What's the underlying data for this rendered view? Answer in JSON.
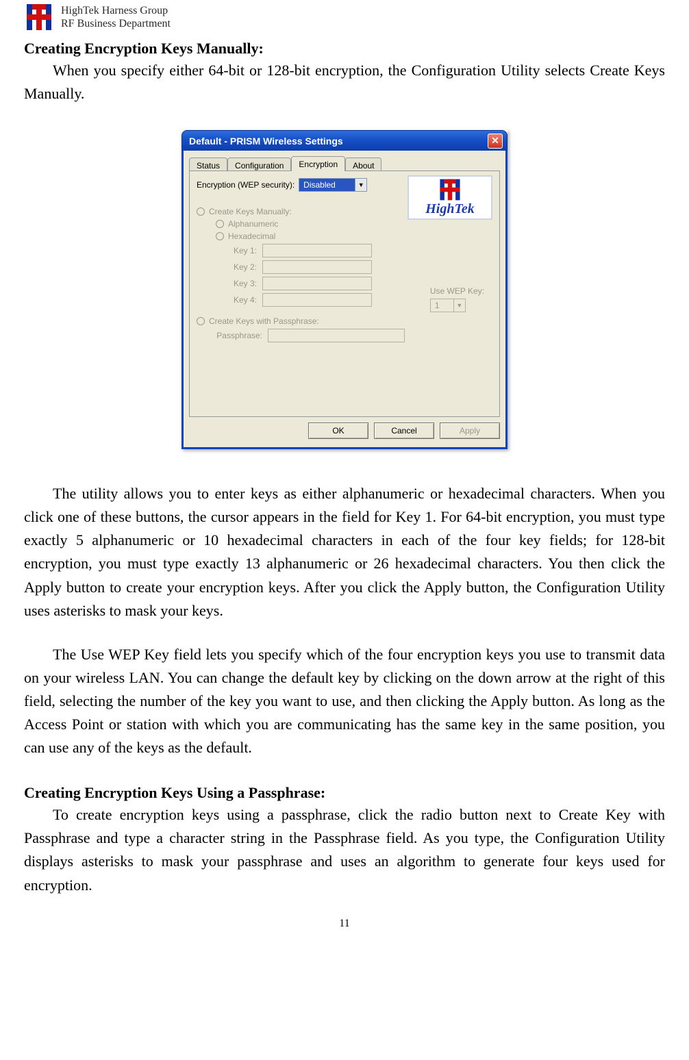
{
  "header": {
    "line1": "HighTek Harness Group",
    "line2": "RF Business Department"
  },
  "section1_heading": "Creating Encryption Keys Manually:",
  "p1": "When you specify either 64-bit or 128-bit encryption, the Configuration Utility selects Create Keys Manually.",
  "p2": "The utility allows you to enter keys as either alphanumeric or hexadecimal characters. When you click one of these buttons, the cursor appears in the field for Key 1. For 64-bit encryption, you must type exactly 5 alphanumeric or 10 hexadecimal characters in each of the four key fields; for 128-bit encryption, you must type exactly 13 alphanumeric or 26 hexadecimal characters. You then click the Apply button to create your encryption keys. After you click the Apply button, the Configuration Utility uses asterisks to mask your keys.",
  "p3": "The Use WEP Key field lets you specify which of the four encryption keys you use to transmit data on your wireless LAN. You can change the default key by clicking on the down arrow at the right of this field, selecting the number of the key you want to use, and then clicking the Apply button. As long as the Access Point or station with which you are communicating has the same key in the same position, you can use any of the keys as the default.",
  "section2_heading": "Creating Encryption Keys Using a Passphrase:",
  "p4": "To create encryption keys using a passphrase, click the radio button next to Create Key with Passphrase and type a character string in the Passphrase field. As you type, the Configuration Utility displays asterisks to mask your passphrase and uses an algorithm to generate four keys used for encryption.",
  "page_num": "11",
  "dialog": {
    "title": "Default - PRISM Wireless Settings",
    "tabs": {
      "status": "Status",
      "config": "Configuration",
      "encryption": "Encryption",
      "about": "About"
    },
    "wep_label": "Encryption (WEP security):",
    "wep_value": "Disabled",
    "badge_text": "HighTek",
    "create_manual": "Create Keys Manually:",
    "alphanumeric": "Alphanumeric",
    "hexadecimal": "Hexadecimal",
    "key1": "Key 1:",
    "key2": "Key 2:",
    "key3": "Key 3:",
    "key4": "Key 4:",
    "use_wep": "Use WEP Key:",
    "use_wep_value": "1",
    "create_passphrase": "Create Keys with Passphrase:",
    "passphrase_label": "Passphrase:",
    "ok": "OK",
    "cancel": "Cancel",
    "apply": "Apply"
  }
}
